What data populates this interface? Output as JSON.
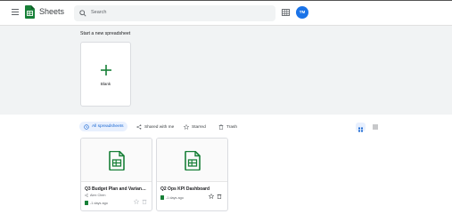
{
  "header": {
    "app_title": "Sheets",
    "search_placeholder": "Search",
    "avatar_initials": "TM"
  },
  "gallery": {
    "title": "Start a new spreadsheet",
    "blank_label": "Blank"
  },
  "filters": {
    "items": [
      {
        "label": "All spreadsheets",
        "active": true
      },
      {
        "label": "Shared with me",
        "active": false
      },
      {
        "label": "Starred",
        "active": false
      },
      {
        "label": "Trash",
        "active": false
      }
    ]
  },
  "files": [
    {
      "name": "Q3 Budget Plan and Varian…",
      "owner": "Alex Chen",
      "shared": true,
      "modified": "-1 days ago"
    },
    {
      "name": "Q2 Ops KPI Dashboard",
      "owner": "",
      "shared": false,
      "modified": "-1 days ago"
    }
  ],
  "colors": {
    "brand_green": "#188038",
    "accent_blue": "#1a73e8",
    "gallery_bg": "#f1f3f4"
  },
  "icons": {
    "menu": "menu-icon",
    "logo": "sheets-logo-icon",
    "search": "search-icon",
    "apps": "apps-grid-icon",
    "plus": "plus-icon",
    "grid_view": "grid-view-icon",
    "list_view": "list-view-icon"
  }
}
